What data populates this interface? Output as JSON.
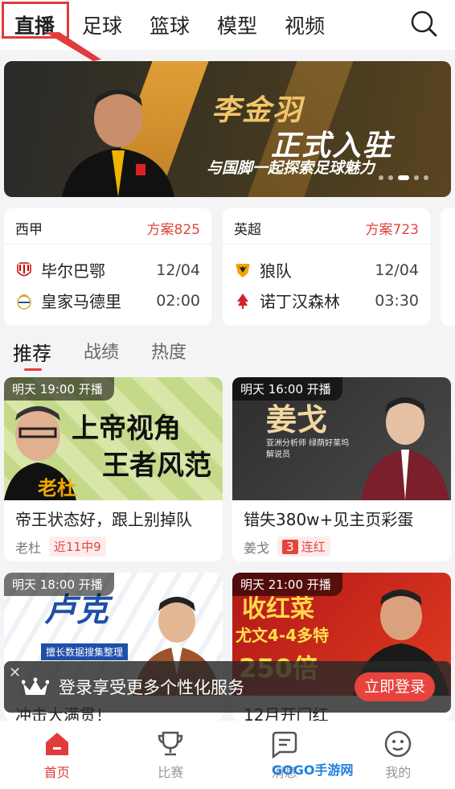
{
  "top_tabs": [
    "直播",
    "足球",
    "篮球",
    "模型",
    "视频"
  ],
  "banner": {
    "line1": "李金羽",
    "line2": "正式入驻",
    "line3": "与国脚一起探索足球魅力"
  },
  "matches": [
    {
      "league": "西甲",
      "plan": "方案825",
      "home": {
        "name": "毕尔巴鄂",
        "value": "12/04"
      },
      "away": {
        "name": "皇家马德里",
        "value": "02:00"
      }
    },
    {
      "league": "英超",
      "plan": "方案723",
      "home": {
        "name": "狼队",
        "value": "12/04"
      },
      "away": {
        "name": "诺丁汉森林",
        "value": "03:30"
      }
    }
  ],
  "sub_tabs": [
    "推荐",
    "战绩",
    "热度"
  ],
  "cards": [
    {
      "badge": "明天 19:00 开播",
      "thumb_line1": "上帝视角",
      "thumb_line2": "王者风范",
      "thumb_name": "老杜",
      "title": "帝王状态好，跟上别掉队",
      "author": "老杜",
      "tag": "近11中9"
    },
    {
      "badge": "明天 16:00 开播",
      "thumb_line1": "姜戈",
      "thumb_line2": "亚洲分析师 绿荫好莱坞解说员",
      "title": "错失380w+见主页彩蛋",
      "author": "姜戈",
      "tag_num": "3",
      "tag": "连红"
    },
    {
      "badge": "明天 18:00 开播",
      "thumb_line1": "卢克",
      "thumb_line2": "擅长数据搜集整理",
      "title": "冲击大满贯！"
    },
    {
      "badge": "明天 21:00 开播",
      "thumb_line1": "收红菜",
      "thumb_line2": "尤文4-4多特",
      "thumb_line3": "250倍",
      "title": "12月开门红"
    }
  ],
  "toast": {
    "text": "登录享受更多个性化服务",
    "button": "立即登录"
  },
  "bottom_nav": [
    "首页",
    "比赛",
    "消息",
    "我的"
  ],
  "watermark": "GOGO手游网",
  "colors": {
    "accent": "#e23b3b",
    "plan": "#e0463e"
  }
}
